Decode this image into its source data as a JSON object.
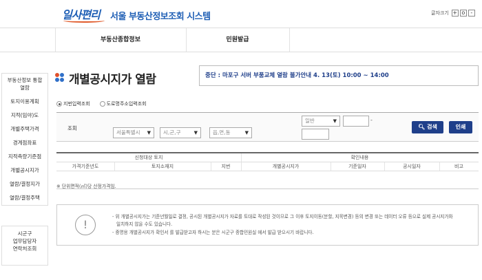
{
  "header": {
    "logo": "일사편리",
    "title": "서울 부동산정보조회 시스템",
    "font_size_label": "글자크기",
    "font_size_plus": "+",
    "font_size_reset": "o",
    "font_size_minus": "-"
  },
  "gnb": {
    "items": [
      "부동산종합정보",
      "민원발급"
    ]
  },
  "sidebar": {
    "items": [
      "부동산정보 통합",
      "열람",
      "토지이용계획",
      "지적(임야)도",
      "개별주택가격",
      "경계점좌표",
      "지적측량기준점",
      "개별공시지가",
      "열람/결정지가",
      "열람/결정주택"
    ],
    "contact": [
      "시군구",
      "업무담당자",
      "연락처조회"
    ]
  },
  "page": {
    "title": "개별공시지가 열람",
    "notice": "중단 : 마포구 서버 부품교체 열람 불가안내 4. 13(토) 10:00 ~ 14:00"
  },
  "search": {
    "radio_jibun": "지번입력조회",
    "radio_road": "도로명주소입력조회",
    "label": "조회",
    "sido": "서울특별시",
    "sigungu": "시,군,구",
    "eupmyeon": "읍,면,동",
    "type": "일반",
    "dash": "-",
    "search_button": "검색",
    "print_button": "인쇄"
  },
  "grid": {
    "group_headers": [
      "신청대상 토지",
      "확인내용"
    ],
    "columns": [
      "가격기준년도",
      "토지소재지",
      "지번",
      "개별공시지가",
      "기준일자",
      "공시일자",
      "비고"
    ]
  },
  "notes": {
    "unit": "※ 단위면적(㎡)당 산정가격임.",
    "info_1": "- 위 개별공시지가는 기준년월일로 결정, 공시된 개별공시지가 자료를 토대로 작성된 것이므로 그 이후 토지이동(분할, 지목변경) 등의 변경 또는 데이터 오류 등으로 실제 공시지가와",
    "info_2": "일치하지 않을 수도 있습니다.",
    "info_3": "- 증명용 개별공시지가 확인서 를 발급받고자 하시는 분은 시군구 종합민원실 에서 발급 받으시기 바랍니다.",
    "info_symbol": "!"
  },
  "colors": {
    "brand_blue": "#1f5fb5",
    "button_navy": "#1f3f8a",
    "icon_red": "#e0502a",
    "icon_blue": "#2f6fc8"
  }
}
